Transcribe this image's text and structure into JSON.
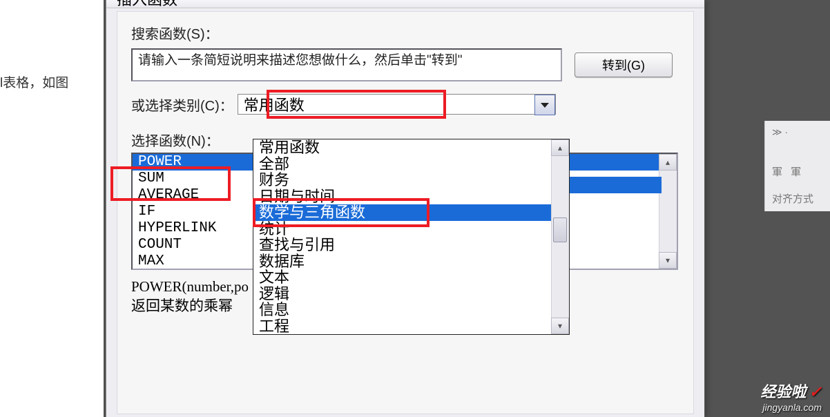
{
  "page_bg_text": "l表格，如图",
  "ribbon": {
    "row1": "≫ ·",
    "row2": "軍 軍",
    "row3": "对齐方式"
  },
  "dialog": {
    "title": "插入函数",
    "search_label": "搜索函数(S)：",
    "search_value": "请输入一条简短说明来描述您想做什么，然后单击\"转到\"",
    "go_btn": "转到(G)",
    "category_label": "或选择类别(C)：",
    "category_value": "常用函数",
    "select_func_label": "选择函数(N)：",
    "functions": [
      "POWER",
      "SUM",
      "AVERAGE",
      "IF",
      "HYPERLINK",
      "COUNT",
      "MAX"
    ],
    "categories": [
      "常用函数",
      "全部",
      "财务",
      "日期与时间",
      "数学与三角函数",
      "统计",
      "查找与引用",
      "数据库",
      "文本",
      "逻辑",
      "信息",
      "工程"
    ],
    "desc_line1": "POWER(number,po",
    "desc_line2": "返回某数的乘幂"
  },
  "watermark": {
    "line1": "经验啦",
    "line2": "jingyanla.com"
  }
}
